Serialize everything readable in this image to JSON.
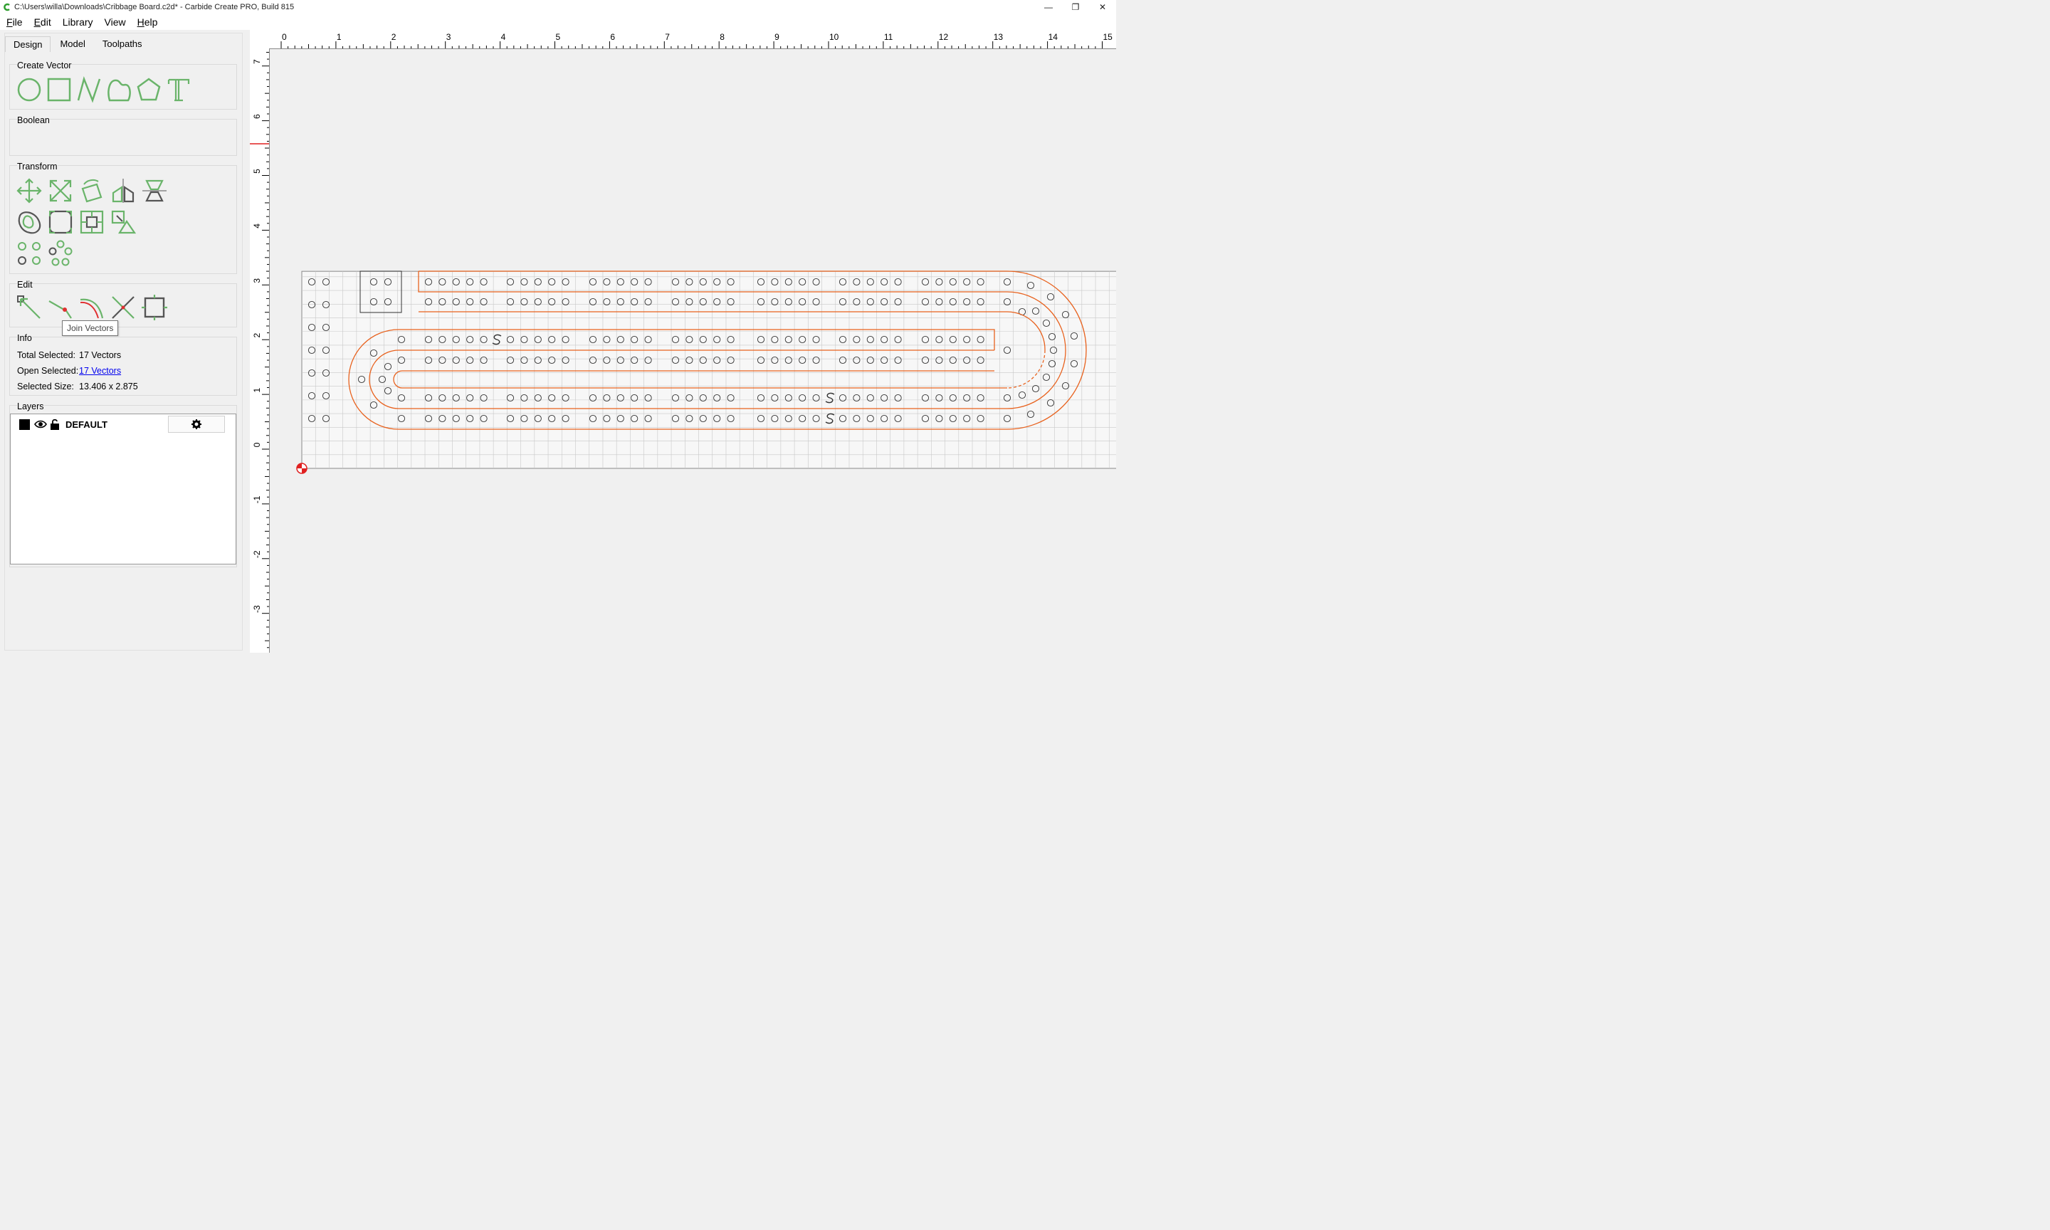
{
  "window": {
    "title": "C:\\Users\\willa\\Downloads\\Cribbage Board.c2d* - Carbide Create PRO, Build 815",
    "controls": [
      "—",
      "❐",
      "✕"
    ]
  },
  "menu": [
    {
      "label": "File",
      "mnemonic": "F",
      "rest": "ile"
    },
    {
      "label": "Edit",
      "mnemonic": "E",
      "rest": "dit"
    },
    {
      "label": "Library",
      "mnemonic": "",
      "rest": "Library"
    },
    {
      "label": "View",
      "mnemonic": "",
      "rest": "View"
    },
    {
      "label": "Help",
      "mnemonic": "H",
      "rest": "elp"
    }
  ],
  "tabs": [
    "Design",
    "Model",
    "Toolpaths"
  ],
  "groups": {
    "create_vector": "Create Vector",
    "boolean": "Boolean",
    "transform": "Transform",
    "edit": "Edit",
    "info": "Info",
    "layers": "Layers"
  },
  "tooltip": "Join Vectors",
  "info": {
    "total_selected_label": "Total Selected:",
    "total_selected_value": "17 Vectors",
    "open_selected_label": "Open Selected:",
    "open_selected_value": "17 Vectors",
    "selected_size_label": "Selected Size:",
    "selected_size_value": "13.406 x 2.875"
  },
  "layers": [
    {
      "name": "DEFAULT",
      "color": "#000000",
      "visible": true,
      "locked": false
    }
  ],
  "ruler": {
    "h_labels": [
      "0",
      "1",
      "2",
      "3",
      "4",
      "5",
      "6",
      "7",
      "8",
      "9",
      "10",
      "11",
      "12",
      "13",
      "14",
      "15"
    ],
    "v_labels": [
      "7",
      "6",
      "5",
      "4",
      "3",
      "2",
      "1",
      "0",
      "-1",
      "-2",
      "-3"
    ]
  },
  "colors": {
    "tool_green": "#6ab46a",
    "path_orange": "#e8621e",
    "stock_border": "#888888",
    "grid": "#c8c8c8"
  }
}
